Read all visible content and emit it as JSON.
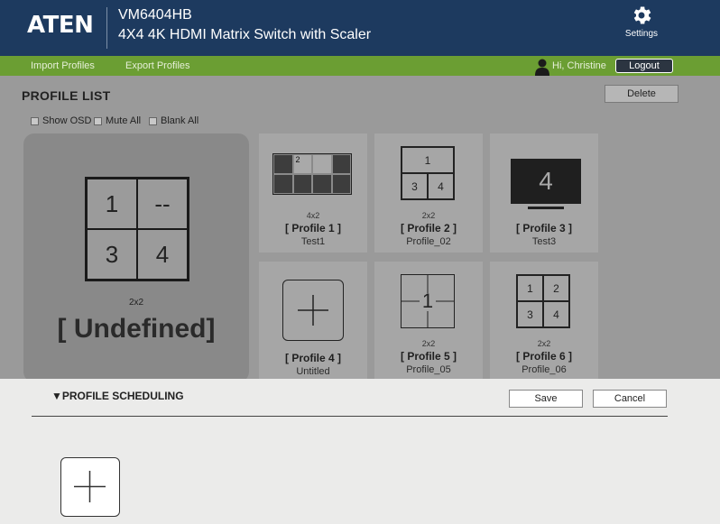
{
  "header": {
    "logo": "ATEN",
    "model": "VM6404HB",
    "description": "4X4 4K HDMI Matrix Switch with Scaler",
    "settings_label": "Settings",
    "settings_icon": "gear-icon"
  },
  "topbar": {
    "import_label": "Import Profiles",
    "export_label": "Export Profiles",
    "greeting": "Hi, Christine",
    "logout_label": "Logout",
    "user_icon": "user-icon"
  },
  "profile_list": {
    "title": "PROFILE LIST",
    "delete_label": "Delete",
    "options": {
      "show_osd": "Show OSD",
      "mute_all": "Mute All",
      "blank_all": "Blank All"
    },
    "current": {
      "cells": [
        "1",
        "--",
        "3",
        "4"
      ],
      "layout": "2x2",
      "name": "[ Undefined]"
    },
    "profiles": [
      {
        "layout": "4x2",
        "name": "[ Profile 1 ]",
        "subtitle": "Test1",
        "cells": [
          "2"
        ]
      },
      {
        "layout": "2x2",
        "name": "[ Profile 2 ]",
        "subtitle": "Profile_02",
        "cells": [
          "1",
          "3",
          "4"
        ]
      },
      {
        "layout": "",
        "name": "[ Profile 3 ]",
        "subtitle": "Test3",
        "cells": [
          "4"
        ]
      },
      {
        "layout": "",
        "name": "[ Profile 4 ]",
        "subtitle": "Untitled",
        "cells": []
      },
      {
        "layout": "2x2",
        "name": "[ Profile 5 ]",
        "subtitle": "Profile_05",
        "cells": [
          "1"
        ]
      },
      {
        "layout": "2x2",
        "name": "[ Profile 6 ]",
        "subtitle": "Profile_06",
        "cells": [
          "1",
          "2",
          "3",
          "4"
        ]
      }
    ]
  },
  "scheduling": {
    "title": "▼PROFILE SCHEDULING",
    "save_label": "Save",
    "cancel_label": "Cancel",
    "add_icon": "plus-icon"
  },
  "colors": {
    "header_bg": "#1d3a5f",
    "green_bar": "#6b9e33",
    "overlay_grey": "#9a9a9a",
    "panel_bg": "#ebebea"
  }
}
